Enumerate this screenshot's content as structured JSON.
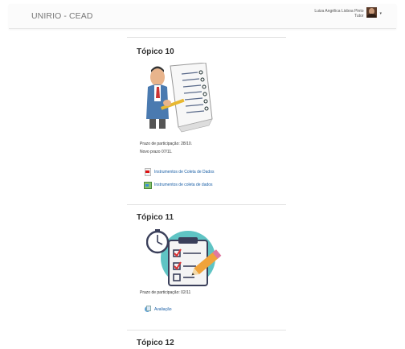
{
  "navbar": {
    "brand": "UNIRIO - CEAD",
    "user_name": "Luiza Angélica Lisboa Pinto",
    "user_role": "Tutor",
    "caret": "▾"
  },
  "sections": [
    {
      "title": "Tópico 10",
      "summary": [
        "Prazo de participação: 28/10.",
        "Novo prazo 07/11."
      ],
      "activities": [
        {
          "label": "Instrumentos de Coleta de Dados",
          "icon": "pdf-file-icon"
        },
        {
          "label": "Instrumentos de coleta de dados",
          "icon": "image-file-icon"
        }
      ]
    },
    {
      "title": "Tópico 11",
      "summary": [
        "Prazo de participação: 02/11"
      ],
      "activities": [
        {
          "label": "Avaliação",
          "icon": "quiz-icon"
        }
      ]
    },
    {
      "title": "Tópico 12"
    }
  ],
  "colors": {
    "link": "#1a5fa6",
    "divider": "#e3e3e3"
  }
}
